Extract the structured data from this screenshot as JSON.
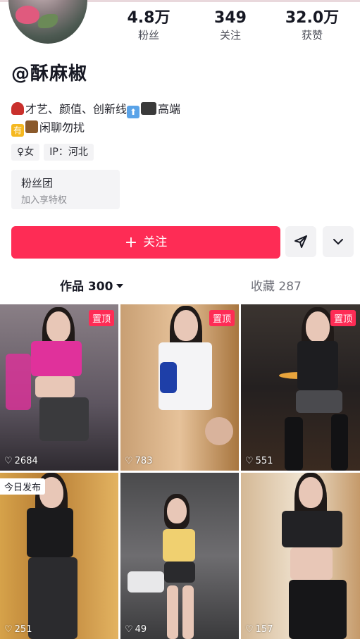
{
  "profile": {
    "username": "@酥麻椒",
    "stats": [
      {
        "value": "4.8万",
        "label": "粉丝"
      },
      {
        "value": "349",
        "label": "关注"
      },
      {
        "value": "32.0万",
        "label": "获赞"
      }
    ],
    "bio_line1": "才艺、颜值、创新线",
    "bio_line1_end": "高端",
    "bio_line2_badge": "有",
    "bio_line2": "闲聊勿扰",
    "tags": [
      "♀女",
      "IP：河北"
    ],
    "fans_group": {
      "title": "粉丝团",
      "subtitle": "加入享特权"
    },
    "follow_label": "关注"
  },
  "tabs": {
    "works": "作品 300",
    "likes": "收藏 287"
  },
  "videos": [
    {
      "likes": "2684",
      "badge": "置顶"
    },
    {
      "likes": "783",
      "badge": "置顶"
    },
    {
      "likes": "551",
      "badge": "置顶"
    },
    {
      "likes": "251",
      "badge": "今日发布"
    },
    {
      "likes": "49",
      "badge": ""
    },
    {
      "likes": "157",
      "badge": ""
    }
  ],
  "colors": {
    "accent": "#fe2c55",
    "text": "#161823",
    "muted": "#6f7079"
  },
  "icons": {
    "send": "send-icon",
    "more": "chevron-down-icon",
    "heart": "heart-outline-icon",
    "plus": "plus-icon"
  }
}
